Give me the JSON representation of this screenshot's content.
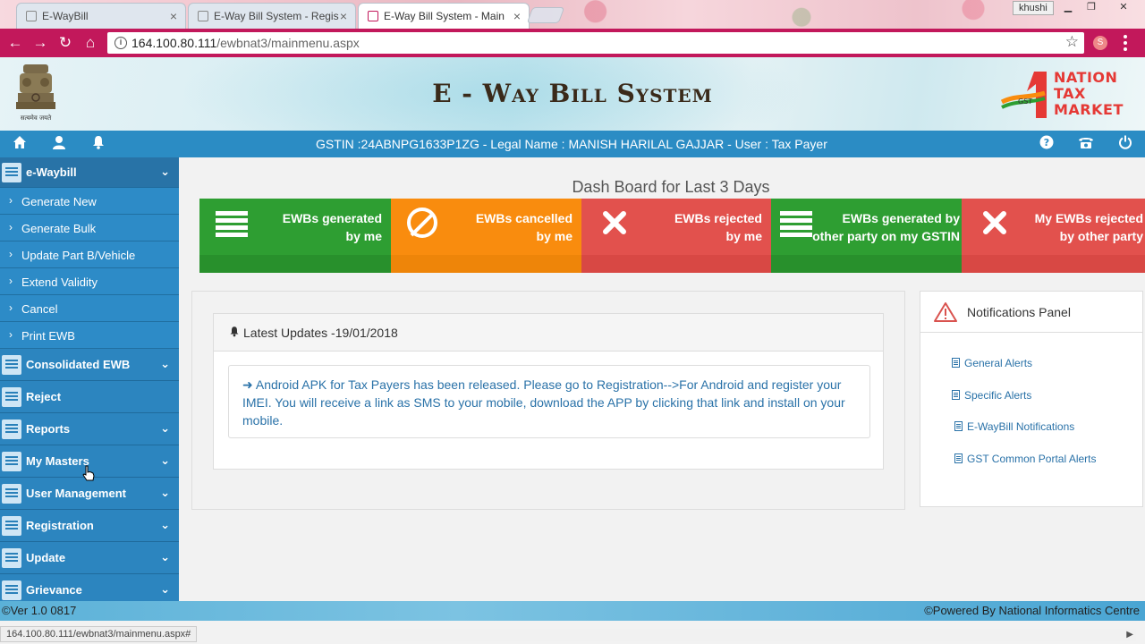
{
  "browser": {
    "tabs": [
      {
        "title": "E-WayBill"
      },
      {
        "title": "E-Way Bill System - Regis"
      },
      {
        "title": "E-Way Bill System - Main"
      }
    ],
    "user_badge": "khushi",
    "url_host": "164.100.80.111",
    "url_path": "/ewbnat3/mainmenu.aspx",
    "status_url": "164.100.80.111/ewbnat3/mainmenu.aspx#"
  },
  "header": {
    "site_title": "E - Way Bill System",
    "logo_lines": [
      "NATION",
      "TAX",
      "MARKET"
    ],
    "logo_badge": "GST",
    "emblem_caption": "सत्यमेव जयते"
  },
  "statusbar": {
    "gstin_text": "GSTIN :24ABNPG1633P1ZG - Legal Name : MANISH HARILAL GAJJAR - User : Tax Payer"
  },
  "sidebar": {
    "top_label": "e-Waybill",
    "sub_items": [
      {
        "label": "Generate New"
      },
      {
        "label": "Generate Bulk"
      },
      {
        "label": "Update Part B/Vehicle"
      },
      {
        "label": "Extend Validity"
      },
      {
        "label": "Cancel"
      },
      {
        "label": "Print EWB"
      }
    ],
    "main_items": [
      {
        "label": "Consolidated EWB"
      },
      {
        "label": "Reject"
      },
      {
        "label": "Reports"
      },
      {
        "label": "My Masters"
      },
      {
        "label": "User Management"
      },
      {
        "label": "Registration"
      },
      {
        "label": "Update"
      },
      {
        "label": "Grievance"
      }
    ]
  },
  "dashboard": {
    "title": "Dash Board for Last 3 Days",
    "cards": [
      {
        "line1": "EWBs generated",
        "line2": "by me",
        "color": "#2e9e32",
        "strip": "#28902c"
      },
      {
        "line1": "EWBs cancelled",
        "line2": "by me",
        "color": "#f98c0e",
        "strip": "#ee8509"
      },
      {
        "line1": "EWBs rejected",
        "line2": "by me",
        "color": "#e2514d",
        "strip": "#d84844"
      },
      {
        "line1": "EWBs generated by",
        "line2": "other party on my GSTIN",
        "color": "#2e9e32",
        "strip": "#28902c"
      },
      {
        "line1": "My EWBs rejected",
        "line2": "by other party",
        "color": "#e2514d",
        "strip": "#d84844"
      }
    ]
  },
  "updates": {
    "title": "Latest Updates -19/01/2018",
    "message": "Android APK for Tax Payers has been released. Please go to Registration-->For Android and register your IMEI. You will receive a link as SMS to your mobile, download the APP by clicking that link and install on your mobile."
  },
  "notifications": {
    "title": "Notifications Panel",
    "links": [
      {
        "label": "General Alerts"
      },
      {
        "label": "Specific Alerts"
      },
      {
        "label": "E-WayBill Notifications"
      },
      {
        "label": "GST Common Portal Alerts"
      }
    ]
  },
  "footer": {
    "version": "Ver 1.0 0817",
    "powered": "Powered By National Informatics Centre"
  },
  "colors": {
    "sidebar": "#2980b9",
    "statusbar": "#2b8cc4",
    "toolbar": "#c2185b"
  }
}
